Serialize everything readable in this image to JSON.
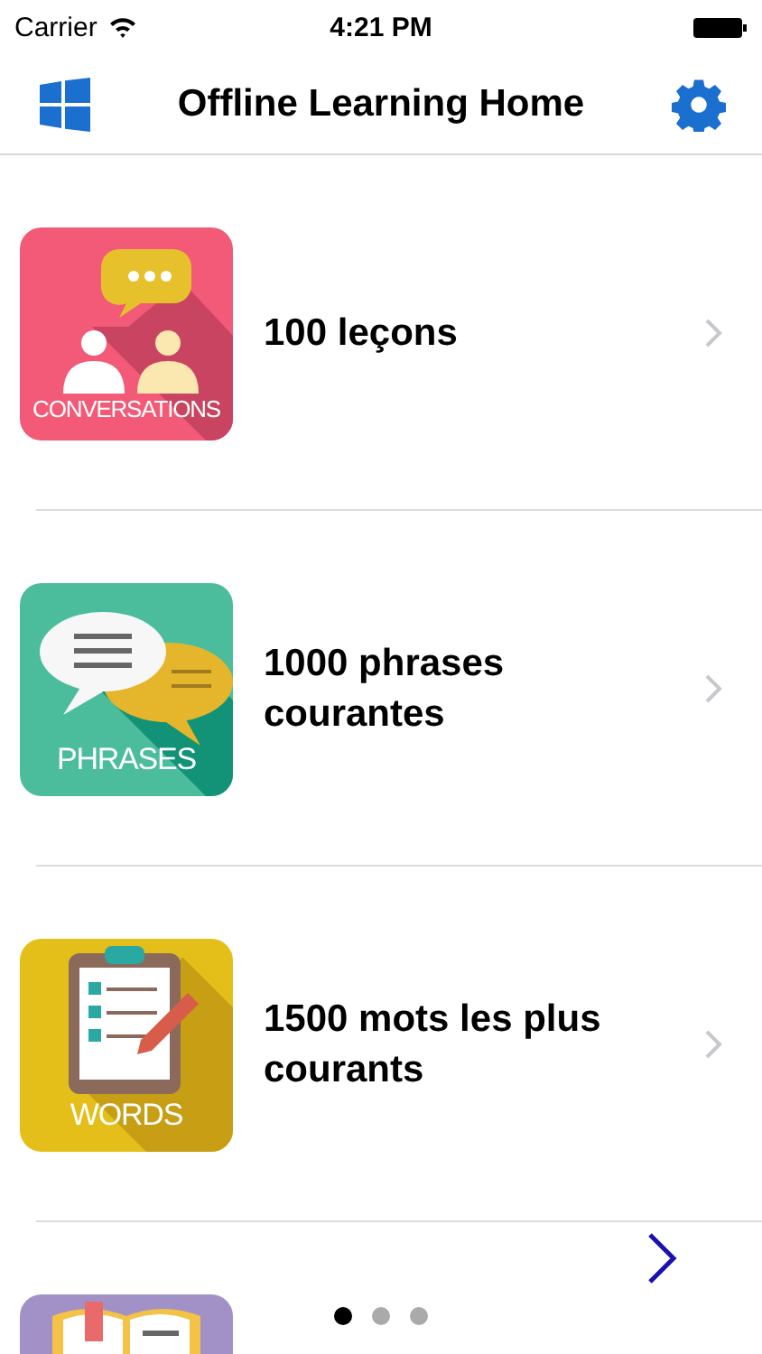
{
  "status_bar": {
    "carrier": "Carrier",
    "time": "4:21 PM"
  },
  "nav_bar": {
    "title": "Offline Learning Home"
  },
  "lessons": [
    {
      "kind": "conversations",
      "tile_label": "CONVERSATIONS",
      "title": "100 leçons"
    },
    {
      "kind": "phrases",
      "tile_label": "PHRASES",
      "title": "1000 phrases courantes"
    },
    {
      "kind": "words",
      "tile_label": "WORDS",
      "title": "1500 mots les plus courants"
    },
    {
      "kind": "book"
    }
  ],
  "pager": {
    "dots": [
      {
        "selected": true
      },
      {
        "selected": false
      },
      {
        "selected": false
      }
    ]
  }
}
